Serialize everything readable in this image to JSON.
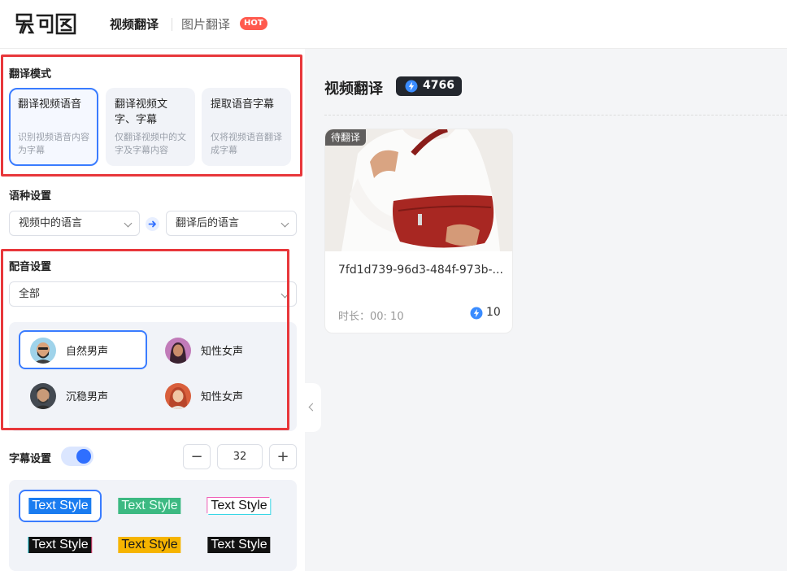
{
  "header": {
    "logo_text": "易可图",
    "tabs": [
      {
        "label": "视频翻译",
        "active": true
      },
      {
        "label": "图片翻译",
        "active": false,
        "badge": "HOT"
      }
    ]
  },
  "sidebar": {
    "mode_section": {
      "title": "翻译模式",
      "modes": [
        {
          "title": "翻译视频语音",
          "desc": "识别视频语音内容为字幕",
          "selected": true
        },
        {
          "title": "翻译视频文字、字幕",
          "desc": "仅翻译视频中的文字及字幕内容",
          "selected": false
        },
        {
          "title": "提取语音字幕",
          "desc": "仅将视频语音翻译成字幕",
          "selected": false
        }
      ]
    },
    "language_section": {
      "title": "语种设置",
      "source_placeholder": "视频中的语言",
      "target_placeholder": "翻译后的语言"
    },
    "dubbing_section": {
      "title": "配音设置",
      "filter": "全部",
      "voices": [
        {
          "label": "自然男声",
          "selected": true
        },
        {
          "label": "知性女声",
          "selected": false
        },
        {
          "label": "沉稳男声",
          "selected": false
        },
        {
          "label": "知性女声",
          "selected": false
        }
      ]
    },
    "subtitle_section": {
      "title": "字幕设置",
      "enabled": true,
      "font_size": "32",
      "minus": "−",
      "plus": "+",
      "styles": [
        {
          "label": "Text Style",
          "selected": true
        },
        {
          "label": "Text Style",
          "selected": false
        },
        {
          "label": "Text Style",
          "selected": false
        },
        {
          "label": "Text Style",
          "selected": false
        },
        {
          "label": "Text Style",
          "selected": false
        },
        {
          "label": "Text Style",
          "selected": false
        }
      ]
    }
  },
  "main": {
    "title": "视频翻译",
    "credits": "4766",
    "videos": [
      {
        "status": "待翻译",
        "filename": "7fd1d739-96d3-484f-973b-...",
        "duration": "时长：00: 10",
        "cost": "10"
      }
    ]
  },
  "colors": {
    "accent": "#3a7cff",
    "highlight_border": "#e8373b",
    "hot_badge": "#ff5a4e",
    "credit_badge_bg": "#23272e"
  }
}
